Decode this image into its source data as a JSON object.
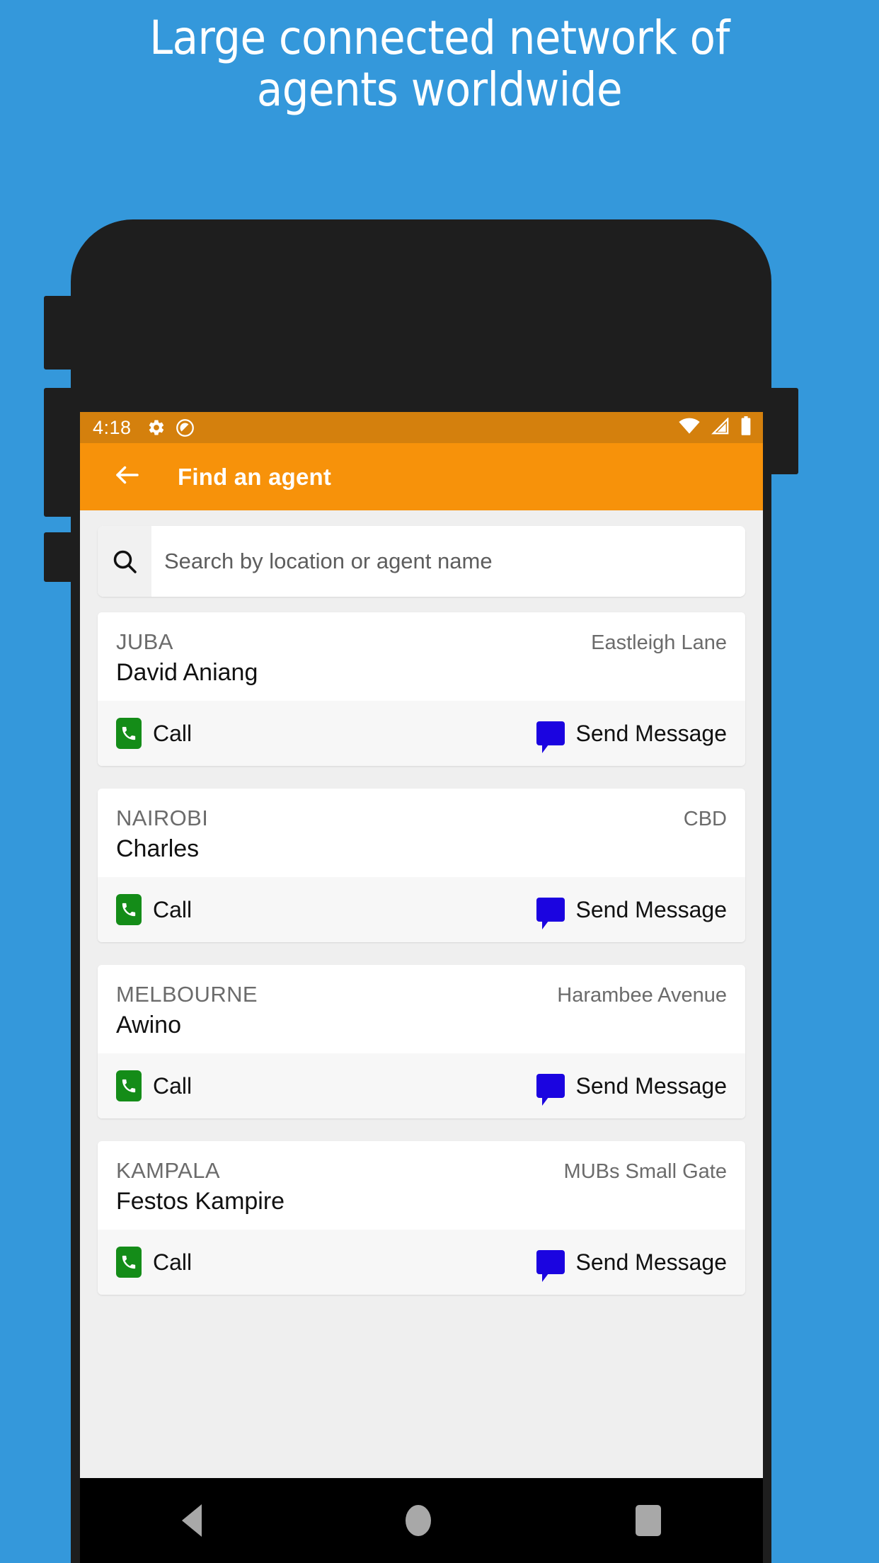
{
  "promo": {
    "headline": "Large connected network of agents worldwide",
    "background_color": "#3498db"
  },
  "device": {
    "frame_color": "#1e1e1e",
    "nav_bar": {
      "back_icon": "triangle-back-icon",
      "home_icon": "circle-home-icon",
      "recents_icon": "square-recents-icon"
    }
  },
  "status_bar": {
    "time": "4:18",
    "left_icons": [
      "gear-icon",
      "do-not-disturb-icon"
    ],
    "right_icons": [
      "wifi-icon",
      "cell-signal-icon",
      "battery-icon"
    ],
    "background_color": "#d4800d"
  },
  "app_bar": {
    "back_label": "back-arrow-icon",
    "title": "Find an agent",
    "background_color": "#f7920a"
  },
  "search": {
    "icon": "search-icon",
    "value": "",
    "placeholder": "Search by location or agent name"
  },
  "actions": {
    "call_label": "Call",
    "message_label": "Send Message",
    "call_icon_color": "#148c18",
    "message_icon_color": "#1b04e0"
  },
  "agents": [
    {
      "city": "JUBA",
      "branch": "Eastleigh Lane",
      "name": "David Aniang",
      "call_label": "Call",
      "message_label": "Send Message"
    },
    {
      "city": "NAIROBI",
      "branch": "CBD",
      "name": "Charles",
      "call_label": "Call",
      "message_label": "Send Message"
    },
    {
      "city": "MELBOURNE",
      "branch": "Harambee Avenue",
      "name": "Awino",
      "call_label": "Call",
      "message_label": "Send Message"
    },
    {
      "city": "KAMPALA",
      "branch": "MUBs Small Gate",
      "name": "Festos Kampire",
      "call_label": "Call",
      "message_label": "Send Message"
    }
  ]
}
